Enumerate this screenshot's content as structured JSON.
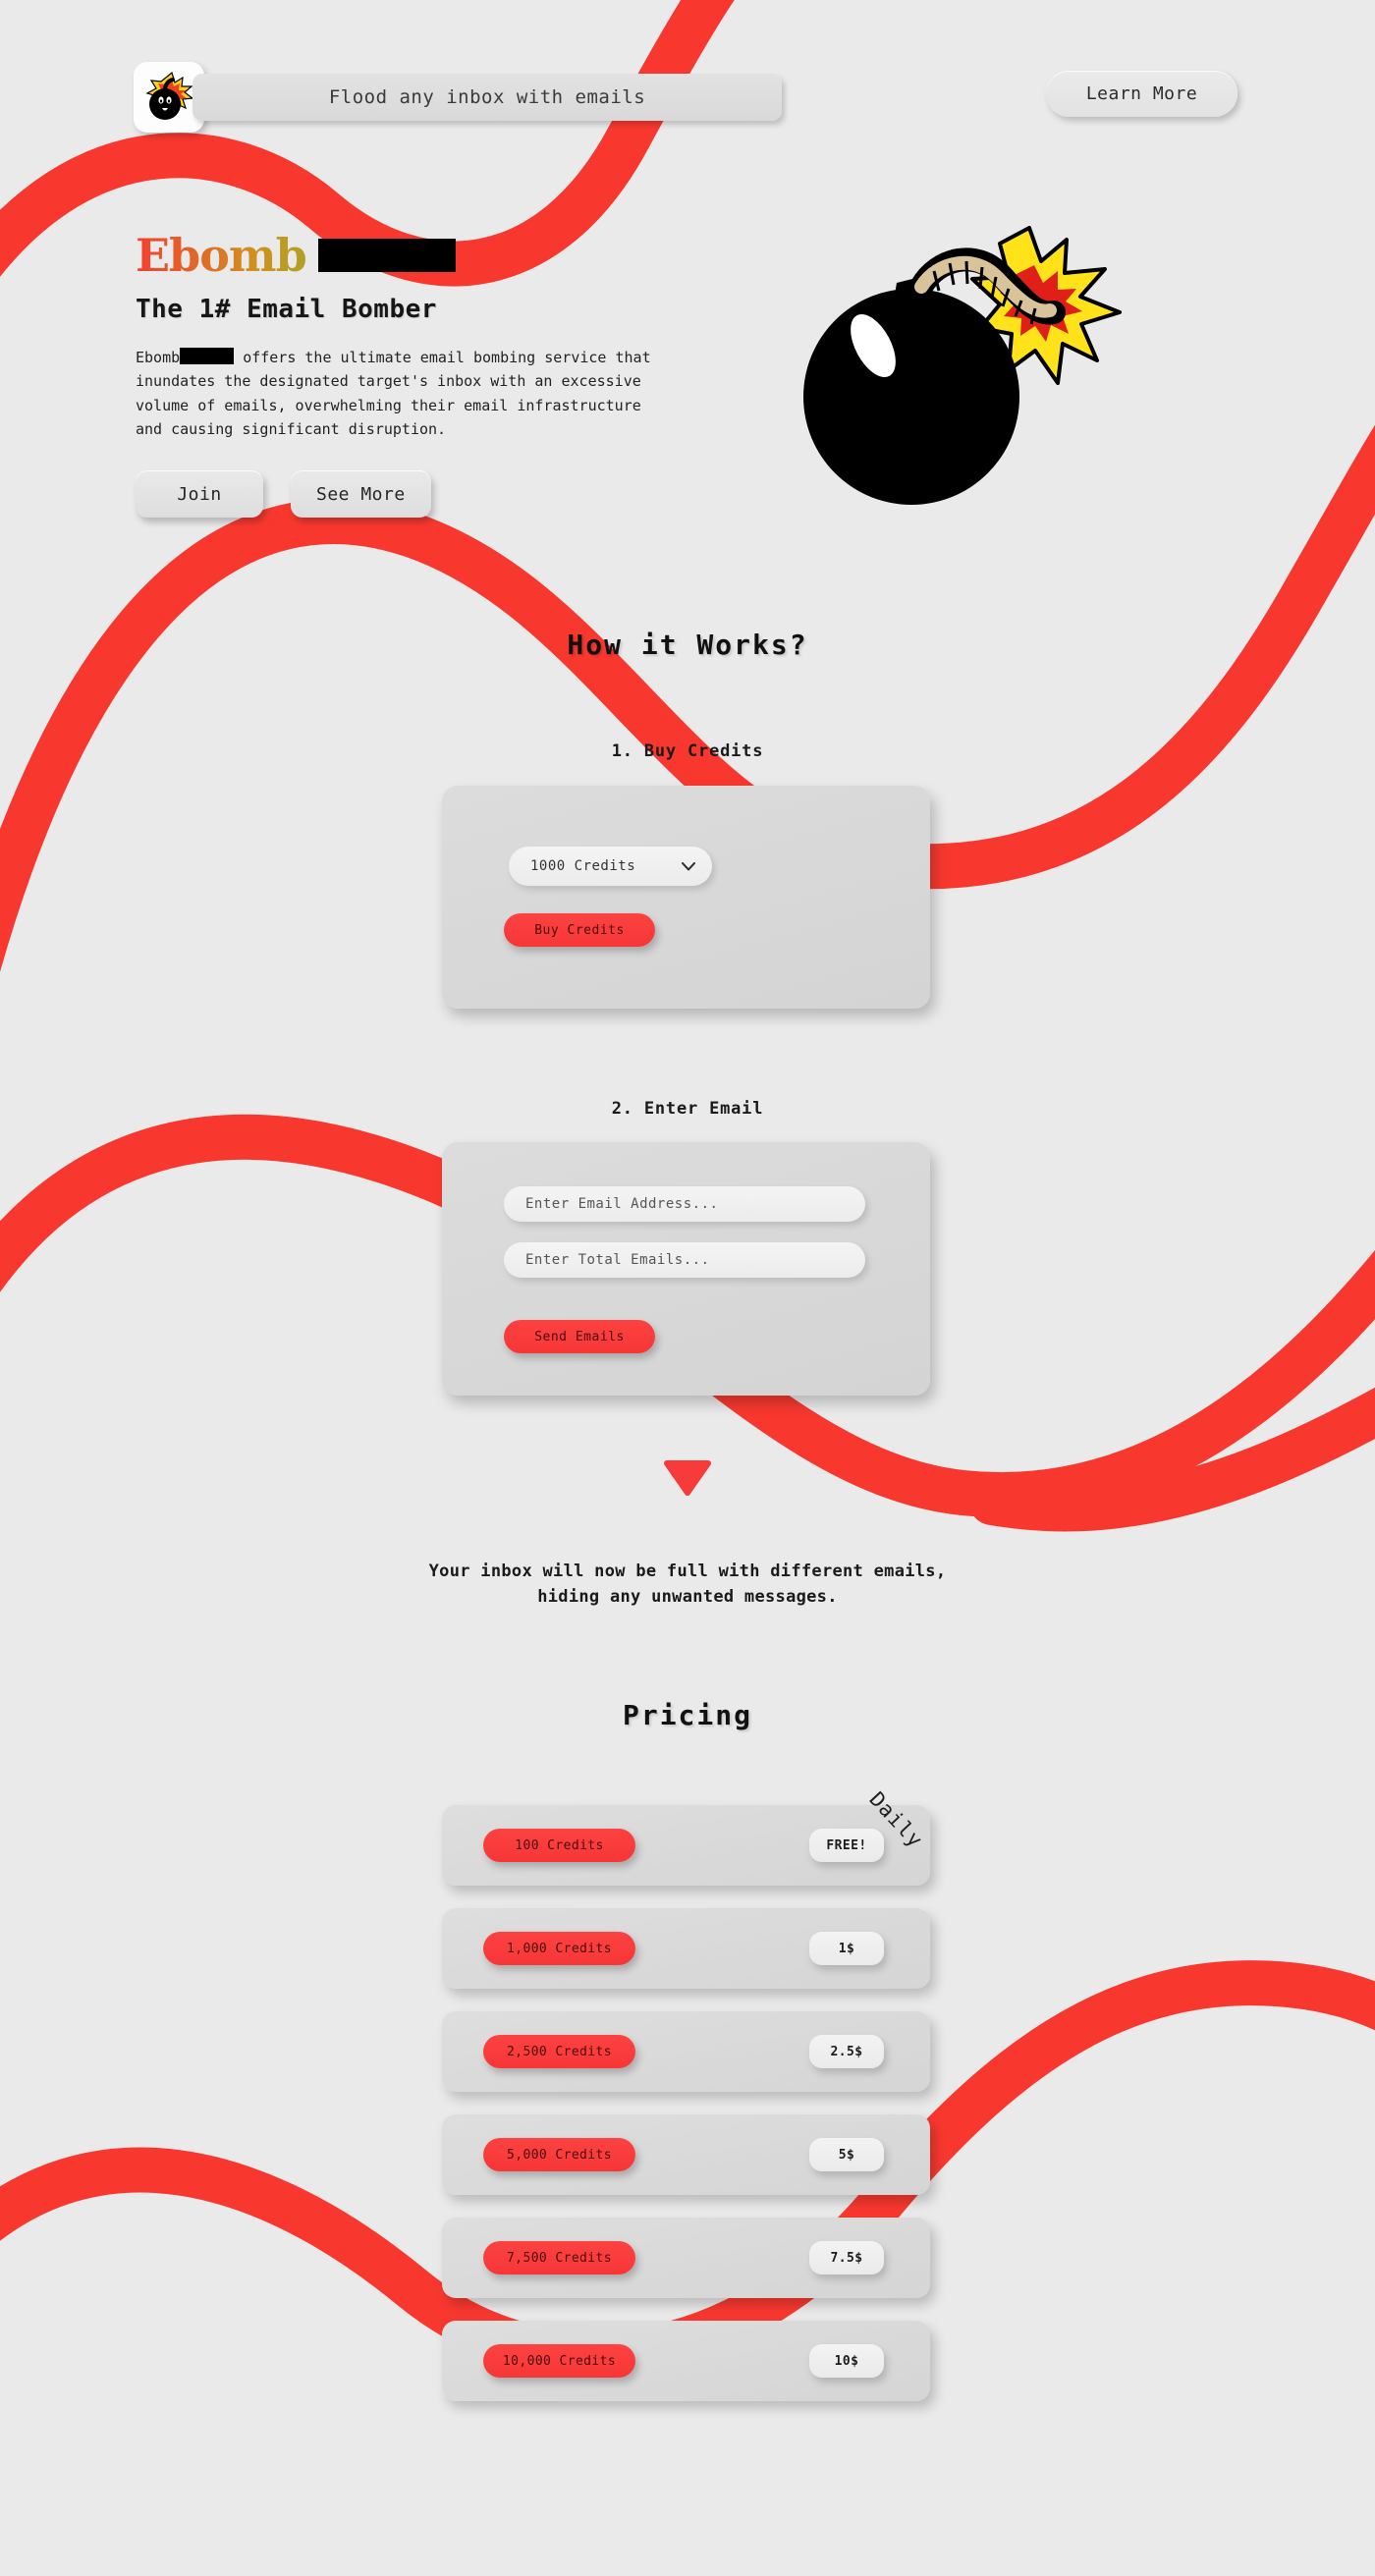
{
  "theme": {
    "background": "#eaeaea",
    "accent_red": "#f73636",
    "panel": "#d8d8d8",
    "text": "#1a1a1a"
  },
  "header": {
    "logo_icon": "bomb-explosion-icon",
    "nav_text": "Flood any inbox with emails",
    "learn_more_label": "Learn More"
  },
  "hero": {
    "brand": "Ebomb",
    "brand_redacted": true,
    "tagline": "The 1# Email Bomber",
    "description_before": "Ebomb",
    "description_after": "offers the ultimate email bombing service that inundates the designated target's inbox with an excessive volume of emails, overwhelming their email infrastructure and causing significant disruption.",
    "join_label": "Join",
    "see_more_label": "See More",
    "illustration": "bomb-with-lit-fuse-icon"
  },
  "how_it_works": {
    "title": "How it Works?",
    "step1": {
      "label": "1. Buy Credits",
      "select_value": "1000 Credits",
      "select_icon": "chevron-down-icon",
      "buy_label": "Buy Credits"
    },
    "step2": {
      "label": "2. Enter Email",
      "email_placeholder": "Enter Email Address...",
      "email_value": "",
      "total_placeholder": "Enter Total Emails...",
      "total_value": "",
      "send_label": "Send Emails"
    },
    "arrow_icon": "triangle-down-icon",
    "outro_line1": "Your inbox will now be full with different emails,",
    "outro_line2": "hiding any unwanted messages."
  },
  "pricing": {
    "title": "Pricing",
    "badge": "Daily",
    "rows": [
      {
        "credits": "100 Credits",
        "price": "FREE!"
      },
      {
        "credits": "1,000 Credits",
        "price": "1$"
      },
      {
        "credits": "2,500 Credits",
        "price": "2.5$"
      },
      {
        "credits": "5,000 Credits",
        "price": "5$"
      },
      {
        "credits": "7,500 Credits",
        "price": "7.5$"
      },
      {
        "credits": "10,000 Credits",
        "price": "10$"
      }
    ]
  }
}
